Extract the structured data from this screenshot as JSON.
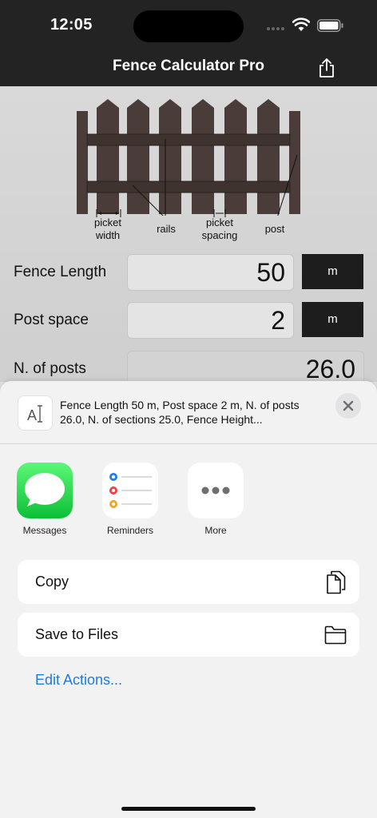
{
  "status": {
    "time": "12:05"
  },
  "nav": {
    "title": "Fence Calculator Pro",
    "share_icon": "share-icon"
  },
  "diagram": {
    "labels": {
      "picket_width": "picket\nwidth",
      "rails": "rails",
      "picket_spacing": "picket\nspacing",
      "post": "post"
    },
    "fence_color": "#4a3c38"
  },
  "form": {
    "rows": [
      {
        "label": "Fence Length",
        "value": "50",
        "unit": "m"
      },
      {
        "label": "Post space",
        "value": "2",
        "unit": "m"
      },
      {
        "label": "N. of posts",
        "value": "26.0"
      }
    ]
  },
  "share_sheet": {
    "preview_text": "Fence Length 50 m, Post space 2 m, N. of posts 26.0, N. of sections 25.0, Fence Height...",
    "preview_icon": "text-document-icon",
    "apps": [
      {
        "name": "Messages",
        "icon": "messages-icon"
      },
      {
        "name": "Reminders",
        "icon": "reminders-icon"
      },
      {
        "name": "More",
        "icon": "more-icon"
      }
    ],
    "actions": [
      {
        "label": "Copy",
        "icon": "copy-icon"
      },
      {
        "label": "Save to Files",
        "icon": "folder-icon"
      }
    ],
    "edit_actions": "Edit Actions...",
    "accent_color": "#1e7be0"
  }
}
